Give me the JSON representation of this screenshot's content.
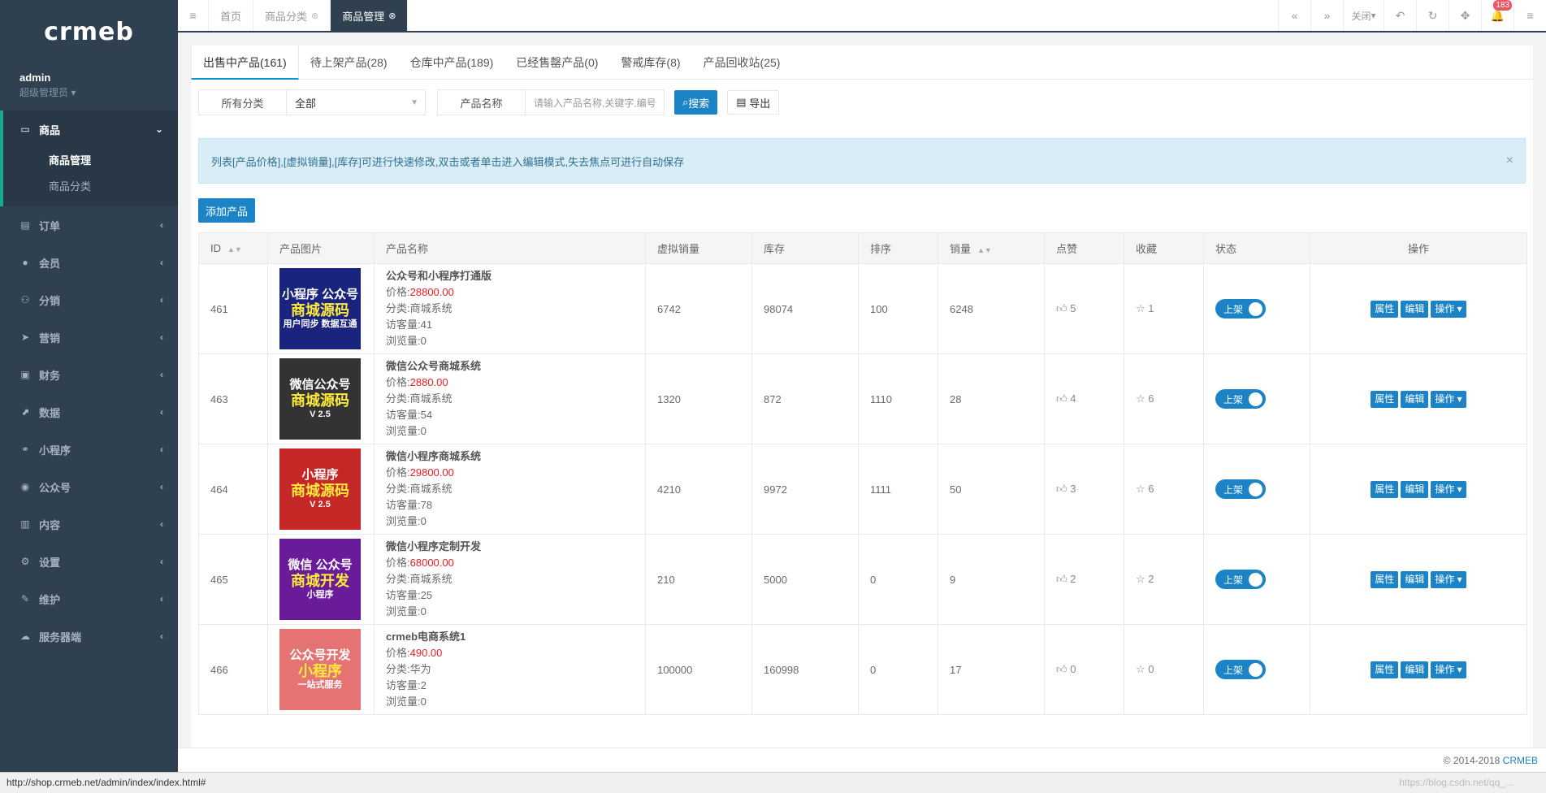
{
  "sidebar": {
    "logo": "crmeb",
    "user": {
      "name": "admin",
      "role": "超级管理员 ▾"
    },
    "active_group": {
      "label": "商品",
      "children": [
        {
          "label": "商品管理"
        },
        {
          "label": "商品分类"
        }
      ]
    },
    "items": [
      {
        "label": "订单",
        "icon": "order-icon"
      },
      {
        "label": "会员",
        "icon": "user-icon"
      },
      {
        "label": "分销",
        "icon": "users-icon"
      },
      {
        "label": "营销",
        "icon": "send-icon"
      },
      {
        "label": "财务",
        "icon": "money-icon"
      },
      {
        "label": "数据",
        "icon": "chart-icon"
      },
      {
        "label": "小程序",
        "icon": "share-icon"
      },
      {
        "label": "公众号",
        "icon": "wechat-icon"
      },
      {
        "label": "内容",
        "icon": "book-icon"
      },
      {
        "label": "设置",
        "icon": "gear-icon"
      },
      {
        "label": "维护",
        "icon": "wrench-icon"
      },
      {
        "label": "服务器端",
        "icon": "cloud-icon"
      }
    ]
  },
  "topbar": {
    "tabs": [
      {
        "label": "首页"
      },
      {
        "label": "商品分类"
      },
      {
        "label": "商品管理"
      }
    ],
    "close_label": "关闭",
    "notification_count": "183"
  },
  "product_tabs": [
    {
      "label": "出售中产品(161)"
    },
    {
      "label": "待上架产品(28)"
    },
    {
      "label": "仓库中产品(189)"
    },
    {
      "label": "已经售罄产品(0)"
    },
    {
      "label": "警戒库存(8)"
    },
    {
      "label": "产品回收站(25)"
    }
  ],
  "filters": {
    "category_label": "所有分类",
    "category_value": "全部",
    "name_label": "产品名称",
    "name_placeholder": "请输入产品名称,关键字,编号",
    "search_label": "搜索",
    "export_label": "导出"
  },
  "alert_text": "列表[产品价格],[虚拟销量],[库存]可进行快速修改,双击或者单击进入编辑模式,失去焦点可进行自动保存",
  "add_button": "添加产品",
  "table": {
    "headers": [
      "ID",
      "产品图片",
      "产品名称",
      "虚拟销量",
      "库存",
      "排序",
      "销量",
      "点赞",
      "收藏",
      "状态",
      "操作"
    ],
    "rows": [
      {
        "id": "461",
        "img": {
          "line1": "小程序 公众号",
          "line2": "商城源码",
          "line3": "用户同步 数据互通",
          "bg": "#1a237e"
        },
        "title": "公众号和小程序打通版",
        "price_label": "价格:",
        "price": "28800.00",
        "category": "分类:商城系统",
        "visits": "访客量:41",
        "views": "浏览量:0",
        "virtual_sales": "6742",
        "stock": "98074",
        "sort": "100",
        "sales": "6248",
        "likes": "5",
        "favorites": "1"
      },
      {
        "id": "463",
        "img": {
          "line1": "微信公众号",
          "line2": "商城源码",
          "line3": "V 2.5",
          "bg": "#333333"
        },
        "title": "微信公众号商城系统",
        "price_label": "价格:",
        "price": "2880.00",
        "category": "分类:商城系统",
        "visits": "访客量:54",
        "views": "浏览量:0",
        "virtual_sales": "1320",
        "stock": "872",
        "sort": "1110",
        "sales": "28",
        "likes": "4",
        "favorites": "6"
      },
      {
        "id": "464",
        "img": {
          "line1": "小程序",
          "line2": "商城源码",
          "line3": "V 2.5",
          "bg": "#c62828"
        },
        "title": "微信小程序商城系统",
        "price_label": "价格:",
        "price": "29800.00",
        "category": "分类:商城系统",
        "visits": "访客量:78",
        "views": "浏览量:0",
        "virtual_sales": "4210",
        "stock": "9972",
        "sort": "1111",
        "sales": "50",
        "likes": "3",
        "favorites": "6"
      },
      {
        "id": "465",
        "img": {
          "line1": "微信 公众号",
          "line2": "商城开发",
          "line3": "小程序",
          "bg": "#6a1b9a"
        },
        "title": "微信小程序定制开发",
        "price_label": "价格:",
        "price": "68000.00",
        "category": "分类:商城系统",
        "visits": "访客量:25",
        "views": "浏览量:0",
        "virtual_sales": "210",
        "stock": "5000",
        "sort": "0",
        "sales": "9",
        "likes": "2",
        "favorites": "2"
      },
      {
        "id": "466",
        "img": {
          "line1": "公众号开发",
          "line2": "小程序",
          "line3": "一站式服务",
          "bg": "#e57373"
        },
        "title": "crmeb电商系统1",
        "price_label": "价格:",
        "price": "490.00",
        "category": "分类:华为",
        "visits": "访客量:2",
        "views": "浏览量:0",
        "virtual_sales": "100000",
        "stock": "160998",
        "sort": "0",
        "sales": "17",
        "likes": "0",
        "favorites": "0"
      }
    ],
    "status_label": "上架",
    "op_labels": [
      "属性",
      "编辑",
      "操作"
    ]
  },
  "footer": {
    "copyright": "© 2014-2018 ",
    "brand": "CRMEB"
  },
  "statusbar": {
    "url": "http://shop.crmeb.net/admin/index/index.html#",
    "watermark": "https://blog.csdn.net/qq_..."
  }
}
